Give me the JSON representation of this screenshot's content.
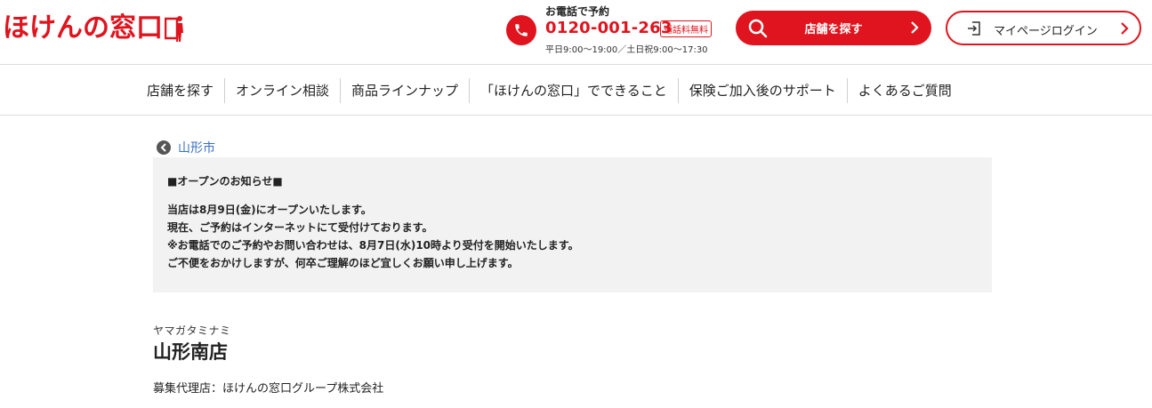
{
  "header": {
    "logo_text": "ほけんの窓口",
    "phone": {
      "label": "お電話で予約",
      "number": "0120-001-263",
      "badge": "通話料無料",
      "hours": "平日9:00〜19:00／土日祝9:00〜17:30"
    },
    "store_button": "店舗を探す",
    "login_button": "マイページログイン"
  },
  "nav": {
    "items": [
      "店舗を探す",
      "オンライン相談",
      "商品ラインナップ",
      "「ほけんの窓口」でできること",
      "保険ご加入後のサポート",
      "よくあるご質問"
    ]
  },
  "breadcrumb": {
    "label": "山形市"
  },
  "notice": {
    "title": "■オープンのお知らせ■",
    "lines": [
      "当店は8月9日(金)にオープンいたします。",
      "現在、ご予約はインターネットにて受付けております。",
      "※お電話でのご予約やお問い合わせは、8月7日(水)10時より受付を開始いたします。",
      "ご不便をおかけしますが、何卒ご理解のほど宜しくお願い申し上げます。"
    ]
  },
  "store": {
    "kana": "ヤマガタミナミ",
    "name": "山形南店",
    "agency": "募集代理店：ほけんの窓口グループ株式会社"
  },
  "colors": {
    "brand_red": "#e0141e",
    "link_blue": "#3a6fc4",
    "notice_bg": "#f2f2f2"
  }
}
